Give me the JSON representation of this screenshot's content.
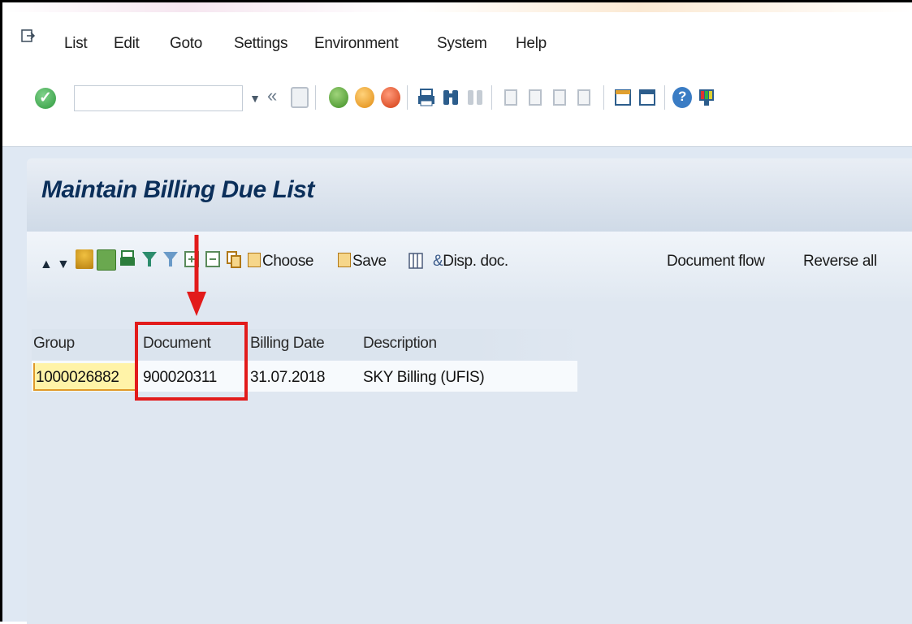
{
  "menu": {
    "items": [
      "List",
      "Edit",
      "Goto",
      "Settings",
      "Environment",
      "System",
      "Help"
    ]
  },
  "toolbar": {
    "command_field_value": "",
    "icons": [
      "enter-icon",
      "command-dropdown-icon",
      "collapse-icon",
      "save-icon",
      "back-icon",
      "exit-icon",
      "cancel-icon",
      "print-icon",
      "find-icon",
      "find-next-icon",
      "first-page-icon",
      "previous-page-icon",
      "next-page-icon",
      "last-page-icon",
      "create-session-icon",
      "shortcut-icon",
      "help-icon",
      "customize-layout-icon"
    ]
  },
  "page": {
    "title": "Maintain Billing Due List"
  },
  "app_toolbar": {
    "buttons": {
      "choose": "Choose",
      "save": "Save",
      "disp_doc": "Disp. doc.",
      "document_flow": "Document flow",
      "reverse_all": "Reverse all"
    },
    "disp_doc_prefix": "&",
    "icons": [
      "sort-up-icon",
      "sort-down-icon",
      "details-icon",
      "select-icon",
      "print-list-icon",
      "filter-icon",
      "filter-set-icon",
      "expand-icon",
      "collapse-all-icon",
      "copy-icon"
    ]
  },
  "table": {
    "columns": [
      "Group",
      "Document",
      "Billing Date",
      "Description"
    ],
    "rows": [
      [
        "1000026882",
        "900020311",
        "31.07.2018",
        "SKY Billing (UFIS)"
      ]
    ]
  },
  "colors": {
    "title": "#0b2f5a",
    "highlight_box": "#e21b1b",
    "selected_cell": "#fff3a8"
  }
}
